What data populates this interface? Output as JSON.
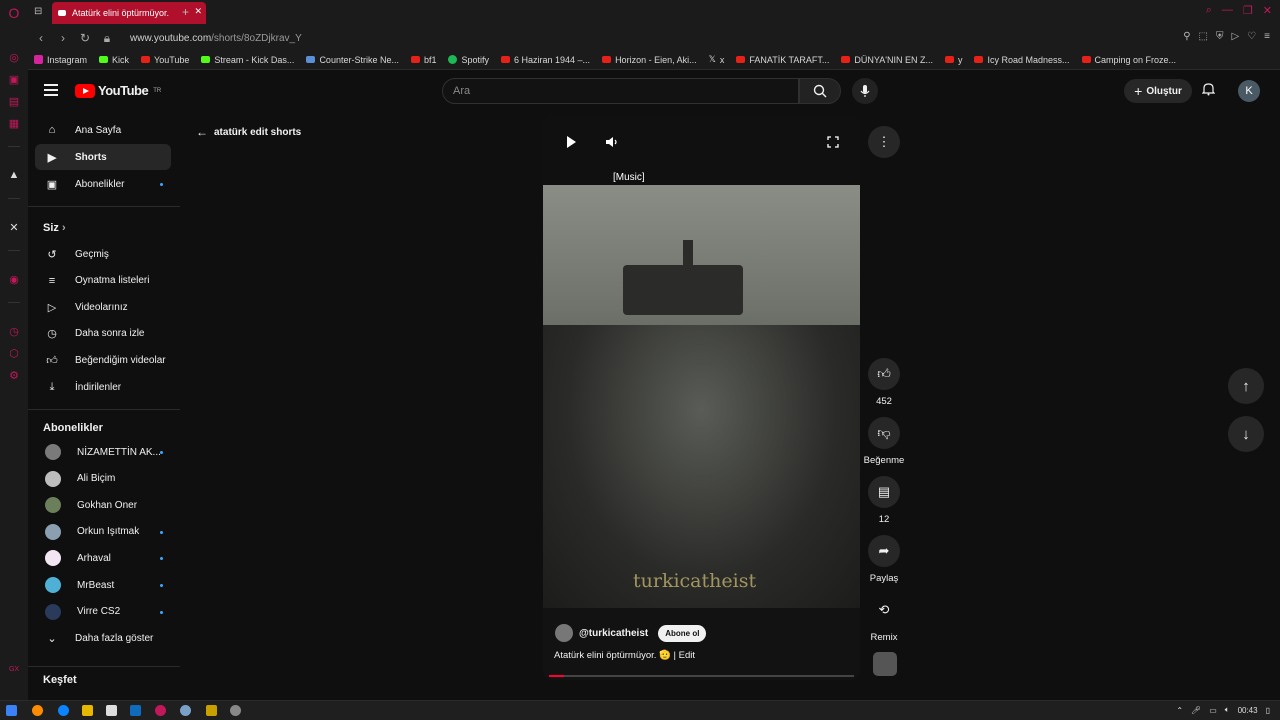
{
  "browser": {
    "tab_title": "Atatürk elini öptürmüyor.",
    "url_host": "www.youtube.com",
    "url_path": "/shorts/8oZDjkrav_Y",
    "bookmarks": [
      {
        "label": "Instagram",
        "icon": "instagram-icon"
      },
      {
        "label": "Kick",
        "icon": "kick-icon"
      },
      {
        "label": "YouTube",
        "icon": "youtube-icon"
      },
      {
        "label": "Stream - Kick Das...",
        "icon": "kick-icon"
      },
      {
        "label": "Counter-Strike Ne...",
        "icon": "cs-icon"
      },
      {
        "label": "bf1",
        "icon": "youtube-icon"
      },
      {
        "label": "Spotify",
        "icon": "spotify-icon"
      },
      {
        "label": "6 Haziran 1944 –...",
        "icon": "youtube-icon"
      },
      {
        "label": "Horizon - Eien, Aki...",
        "icon": "youtube-icon"
      },
      {
        "label": "x",
        "icon": "x-icon"
      },
      {
        "label": "FANATİK TARAFT...",
        "icon": "youtube-icon"
      },
      {
        "label": "DÜNYA'NIN EN Z...",
        "icon": "youtube-icon"
      },
      {
        "label": "y",
        "icon": "youtube-icon"
      },
      {
        "label": "Icy Road Madness...",
        "icon": "youtube-icon"
      },
      {
        "label": "Camping on Froze...",
        "icon": "youtube-icon"
      }
    ]
  },
  "masthead": {
    "logo_text": "YouTube",
    "logo_sup": "TR",
    "search_placeholder": "Ara",
    "create_label": "Oluştur",
    "avatar_letter": "K"
  },
  "sidebar": {
    "main": [
      {
        "label": "Ana Sayfa",
        "icon": "home-icon"
      },
      {
        "label": "Shorts",
        "icon": "shorts-icon"
      },
      {
        "label": "Abonelikler",
        "icon": "subscriptions-icon"
      }
    ],
    "you_heading": "Siz",
    "you": [
      {
        "label": "Geçmiş",
        "icon": "history-icon"
      },
      {
        "label": "Oynatma listeleri",
        "icon": "playlists-icon"
      },
      {
        "label": "Videolarınız",
        "icon": "your-videos-icon"
      },
      {
        "label": "Daha sonra izle",
        "icon": "watch-later-icon"
      },
      {
        "label": "Beğendiğim videolar",
        "icon": "liked-icon"
      },
      {
        "label": "İndirilenler",
        "icon": "download-icon"
      }
    ],
    "subs_heading": "Abonelikler",
    "subs": [
      {
        "label": "NİZAMETTİN AK...",
        "color": "#7a7a7a"
      },
      {
        "label": "Ali Biçim",
        "color": "#bdbdbd"
      },
      {
        "label": "Gokhan Oner",
        "color": "#6b7f5a"
      },
      {
        "label": "Orkun Işıtmak",
        "color": "#8aa0b0"
      },
      {
        "label": "Arhaval",
        "color": "#f3e6f3"
      },
      {
        "label": "MrBeast",
        "color": "#4fb0d6"
      },
      {
        "label": "Virre CS2",
        "color": "#2a3a5a"
      }
    ],
    "show_more": "Daha fazla göster",
    "explore_heading": "Keşfet"
  },
  "back_label": "atatürk edit shorts",
  "player": {
    "caption": "[Music]",
    "watermark": "turkicatheist",
    "channel": "@turkicatheist",
    "subscribe_label": "Abone ol",
    "description": "Atatürk elini öptürmüyor. 🫡 | Edit",
    "progress_fraction": 0.05
  },
  "actions": {
    "likes": "452",
    "dislike_label": "Beğenme",
    "comments": "12",
    "share_label": "Paylaş",
    "remix_label": "Remix"
  },
  "taskbar": {
    "time": "00:43"
  }
}
